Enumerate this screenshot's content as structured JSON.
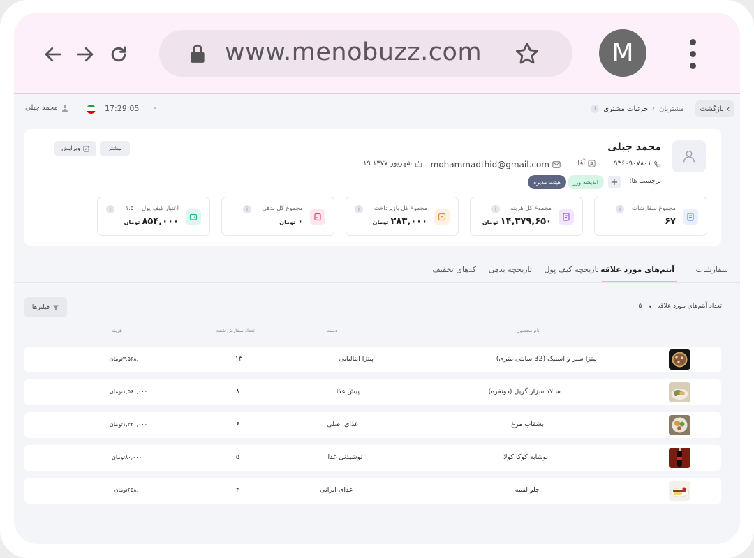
{
  "browser": {
    "url": "www.menobuzz.com",
    "profile_initial": "M"
  },
  "topbar": {
    "back_label": "بازگشت",
    "crumb_parent": "مشتریان",
    "crumb_current": "جزئیات مشتری",
    "time": "17:29:05",
    "user_name": "محمد جبلی"
  },
  "profile": {
    "name": "محمد جبلی",
    "phone": "۰۹۳۶۰۹۰۷۸۰۱",
    "gender": "آقا",
    "email": "mohammadthid@gmail.com",
    "birthday": "۱۹ شهریور ۱۳۷۷",
    "tags_label": "برچسب ها:",
    "tags": [
      "اندیشه ورز",
      "هیئت مدیره"
    ],
    "more_label": "بیشتر",
    "edit_label": "ویرایش"
  },
  "stats": [
    {
      "label": "مجموع سفارشات",
      "value": "۶۷",
      "unit": "",
      "color": "#6f8cf0",
      "bg": "#eaefff"
    },
    {
      "label": "مجموع کل هزینه",
      "value": "۱۴,۳۷۹,۶۵۰",
      "unit": "تومان",
      "color": "#9b5de5",
      "bg": "#f1e8ff"
    },
    {
      "label": "مجموع کل بازپرداخت",
      "value": "۲۸۳,۰۰۰",
      "unit": "تومان",
      "color": "#e88a2e",
      "bg": "#fff1e2"
    },
    {
      "label": "مجموع کل بدهی",
      "value": "۰",
      "unit": "تومان",
      "color": "#e0457b",
      "bg": "#ffe6ef"
    },
    {
      "label": "اعتبار کیف پول",
      "value": "۸۵۴,۰۰۰",
      "unit": "تومان",
      "badge": "۱.۵",
      "color": "#22b59a",
      "bg": "#e0f7f1"
    }
  ],
  "tabs": [
    "سفارشات",
    "آیتم‌های مورد علاقه",
    "تاریخچه کیف پول",
    "تاریخچه بدهی",
    "کدهای تخفیف"
  ],
  "list": {
    "count_label": "تعداد آیتم‌های مورد علاقه",
    "count_value": "۵",
    "filters_label": "فیلترها",
    "columns": [
      "نام محصول",
      "دسته",
      "تعداد سفارش شده",
      "هزینه"
    ],
    "rows": [
      {
        "product": "پیتزا سیر و اسنیک (32 سانتی متری)",
        "category": "پیتزا ایتالیایی",
        "qty": "۱۳",
        "cost": "۳,۵۶۸,۰۰۰",
        "unit": "تومان"
      },
      {
        "product": "سالاد سزار گریل (دونفره)",
        "category": "پیش غذا",
        "qty": "۸",
        "cost": "۱,۵۶۰,۰۰۰",
        "unit": "تومان"
      },
      {
        "product": "بشقاب مرغ",
        "category": "غذای اصلی",
        "qty": "۶",
        "cost": "۱,۳۲۰,۰۰۰",
        "unit": "تومان"
      },
      {
        "product": "نوشابه کوکا کولا",
        "category": "نوشیدنی غذا",
        "qty": "۵",
        "cost": "۸۰,۰۰۰",
        "unit": "تومان"
      },
      {
        "product": "چلو لقمه",
        "category": "غذای ایرانی",
        "qty": "۴",
        "cost": "۶۵۸,۰۰۰",
        "unit": "تومان"
      }
    ]
  }
}
